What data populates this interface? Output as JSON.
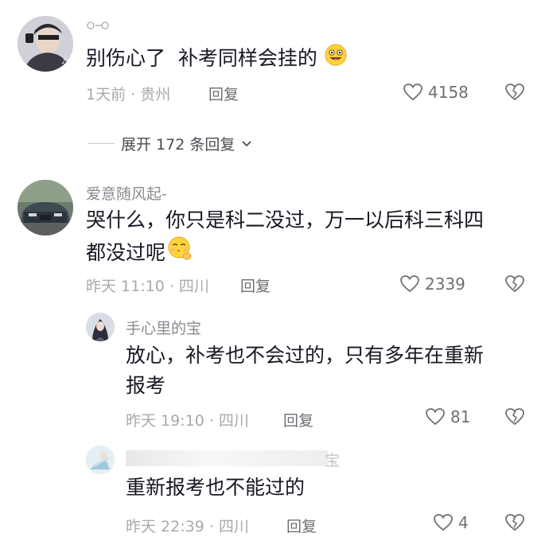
{
  "comments": [
    {
      "username": "",
      "text": "别伤心了  补考同样会挂的",
      "meta": "1天前 · 贵州",
      "reply_label": "回复",
      "likes": "4158",
      "emoji": "grinning-tongue-emoji"
    },
    {
      "username": "爱意随风起-",
      "text_line1": "哭什么，你只是科二没过，万一以后科三科四",
      "text_line2": "都没过呢",
      "meta": "昨天 11:10 · 四川",
      "reply_label": "回复",
      "likes": "2339",
      "emoji": "face-blowing-kiss-emoji"
    }
  ],
  "expand_label": "展开 172 条回复",
  "replies": [
    {
      "username": "手心里的宝",
      "text_line1": "放心，补考也不会过的，只有多年在重新",
      "text_line2": "报考",
      "meta": "昨天 19:10 · 四川",
      "reply_label": "回复",
      "likes": "81"
    },
    {
      "username": "",
      "username_tail": "宝",
      "text": "重新报考也不能过的",
      "meta": "昨天 22:39 · 四川",
      "reply_label": "回复",
      "likes": "4"
    }
  ],
  "icons": {
    "like": "heart-outline-icon",
    "dislike": "broken-heart-icon",
    "expand_chevron": "chevron-down-icon"
  },
  "colors": {
    "text": "#161823",
    "secondary": "#a8a9ad",
    "action": "#6e6f75"
  }
}
